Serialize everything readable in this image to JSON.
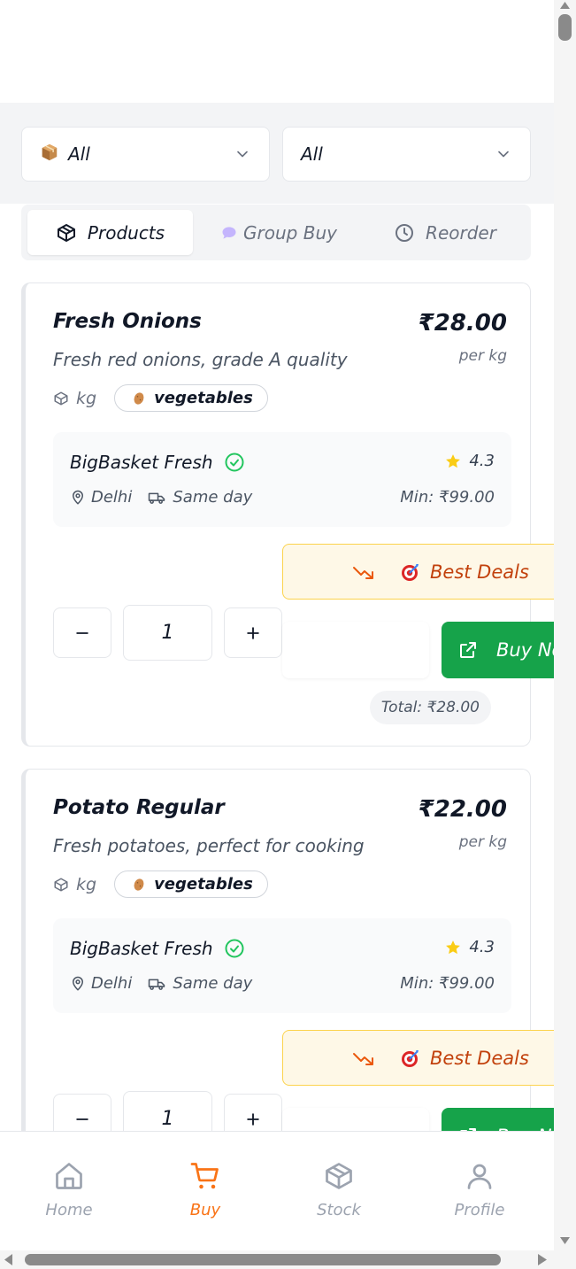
{
  "filters": {
    "category": {
      "icon": "package-emoji",
      "value": "All"
    },
    "second": {
      "value": "All"
    }
  },
  "tabs": [
    {
      "label": "Products",
      "icon": "box-icon",
      "active": true
    },
    {
      "label": "Group Buy",
      "icon": "speech-bubble-emoji",
      "active": false
    },
    {
      "label": "Reorder",
      "icon": "clock-icon",
      "active": false
    }
  ],
  "products": [
    {
      "name": "Fresh Onions",
      "price": "₹28.00",
      "unit_label": "per kg",
      "description": "Fresh red onions, grade A quality",
      "unit": "kg",
      "category": "vegetables",
      "seller": {
        "name": "BigBasket Fresh",
        "rating": "4.3",
        "location": "Delhi",
        "delivery": "Same day",
        "min_order": "Min: ₹99.00"
      },
      "deals_label": "Best Deals",
      "quantity": "1",
      "buy_label": "Buy Now",
      "total": "Total: ₹28.00"
    },
    {
      "name": "Potato Regular",
      "price": "₹22.00",
      "unit_label": "per kg",
      "description": "Fresh potatoes, perfect for cooking",
      "unit": "kg",
      "category": "vegetables",
      "seller": {
        "name": "BigBasket Fresh",
        "rating": "4.3",
        "location": "Delhi",
        "delivery": "Same day",
        "min_order": "Min: ₹99.00"
      },
      "deals_label": "Best Deals",
      "quantity": "1",
      "buy_label": "Buy Now",
      "total": ""
    }
  ],
  "nav": [
    {
      "label": "Home",
      "icon": "home-icon",
      "active": false
    },
    {
      "label": "Buy",
      "icon": "cart-icon",
      "active": true
    },
    {
      "label": "Stock",
      "icon": "box-icon",
      "active": false
    },
    {
      "label": "Profile",
      "icon": "user-icon",
      "active": false
    }
  ],
  "colors": {
    "accent": "#f97316",
    "buy_green": "#16a34a",
    "verified_green": "#22c55e",
    "deals_bg": "#fef8e7",
    "deals_border": "#fcd34d",
    "deals_text": "#c2410c",
    "star": "#facc15"
  }
}
